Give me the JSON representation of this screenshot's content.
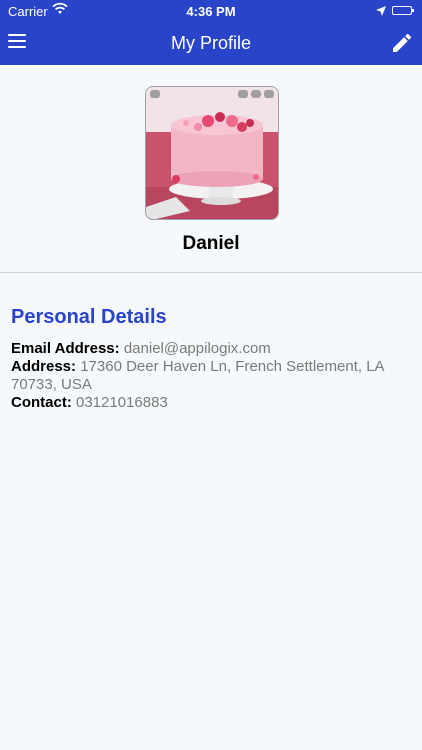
{
  "status_bar": {
    "carrier": "Carrier",
    "time": "4:36 PM"
  },
  "nav": {
    "title": "My Profile"
  },
  "profile": {
    "name": "Daniel"
  },
  "personal_details": {
    "title": "Personal Details",
    "email_label": "Email Address:",
    "email_value": "daniel@appilogix.com",
    "address_label": "Address:",
    "address_value": "17360 Deer Haven Ln, French Settlement, LA 70733, USA",
    "contact_label": "Contact:",
    "contact_value": "03121016883"
  },
  "colors": {
    "accent": "#2a44c9",
    "background": "#f6f9fb",
    "muted_text": "#7a7a7a"
  },
  "icons": {
    "menu": "hamburger-icon",
    "edit": "pencil-icon",
    "wifi": "wifi-icon",
    "location": "location-arrow-icon",
    "battery": "battery-icon"
  }
}
